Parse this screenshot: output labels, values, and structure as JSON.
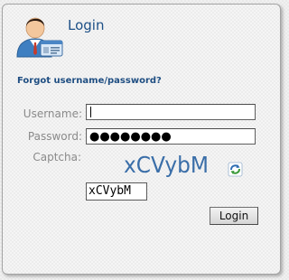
{
  "header": {
    "title": "Login",
    "icon": "user-id-card-icon"
  },
  "links": {
    "forgot": "Forgot username/password?"
  },
  "form": {
    "username_label": "Username:",
    "username_value": "",
    "password_label": "Password:",
    "password_masked": "●●●●●●●●",
    "captcha_label": "Captcha:",
    "captcha_text": "xCVybM",
    "captcha_input_value": "xCVybM",
    "refresh_icon": "refresh-captcha-icon",
    "login_button": "Login"
  },
  "colors": {
    "title": "#1c4f86",
    "link": "#1f4e82",
    "label": "#8a8a8a",
    "captcha": "#3a6ea8"
  }
}
